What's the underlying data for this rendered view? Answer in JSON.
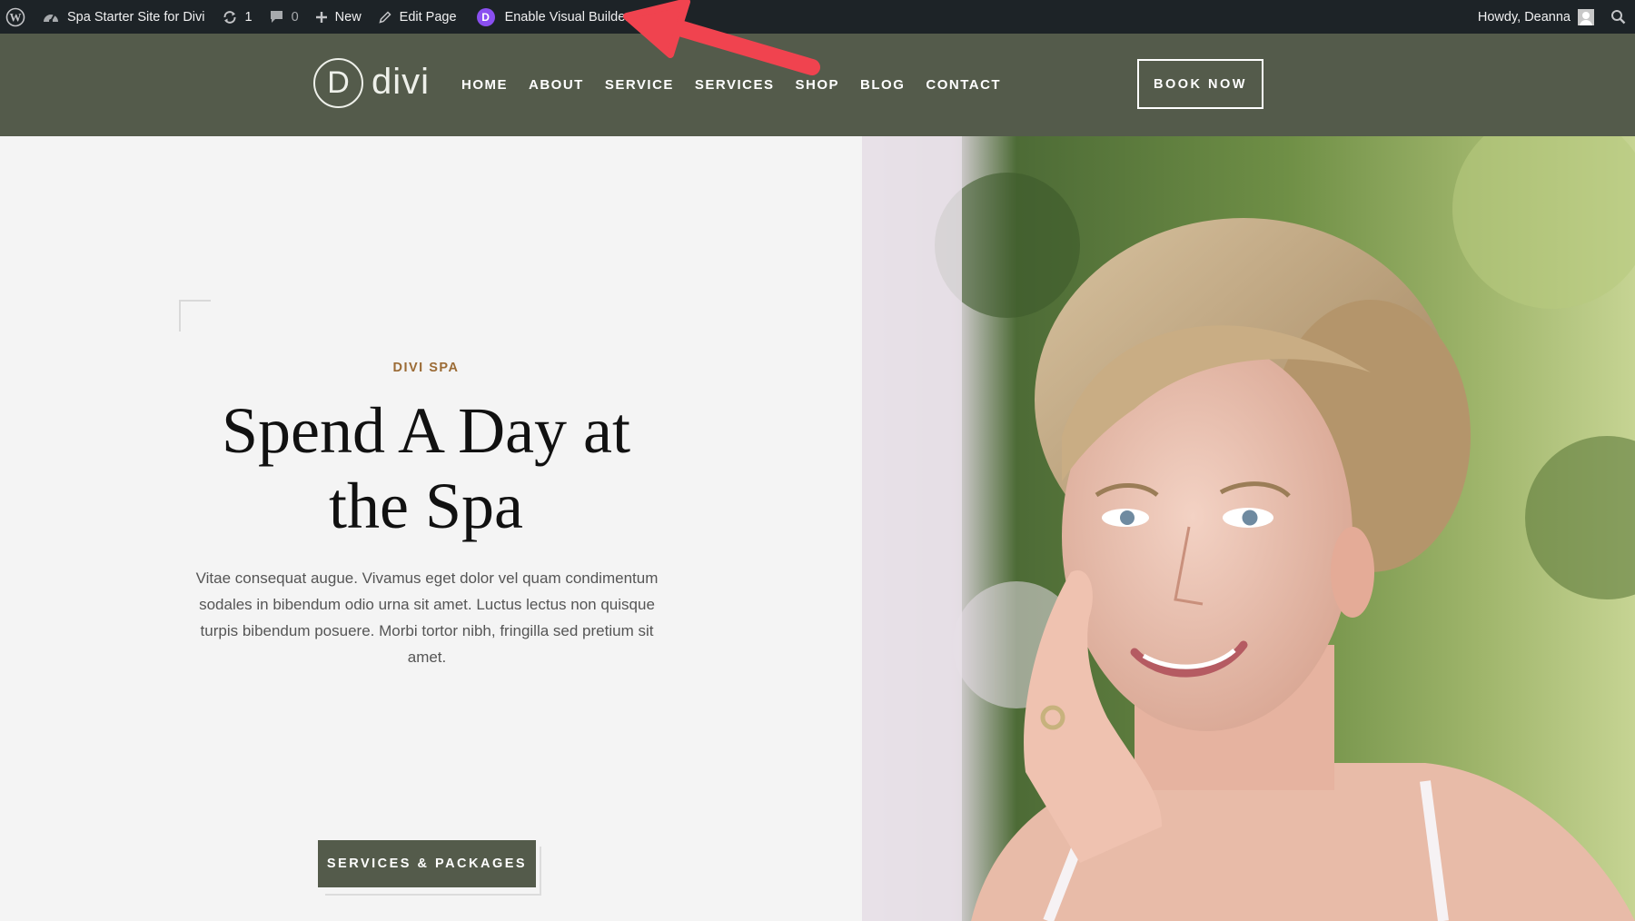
{
  "admin_bar": {
    "site_name": "Spa Starter Site for Divi",
    "updates_count": "1",
    "comments_count": "0",
    "new_label": "New",
    "edit_page_label": "Edit Page",
    "divi_badge": "D",
    "visual_builder_label": "Enable Visual Builder",
    "greeting": "Howdy, Deanna"
  },
  "header": {
    "logo_mark": "D",
    "logo_text": "divi",
    "nav": [
      "HOME",
      "ABOUT",
      "SERVICE",
      "SERVICES",
      "SHOP",
      "BLOG",
      "CONTACT"
    ],
    "book_now_label": "BOOK NOW"
  },
  "hero": {
    "eyebrow": "DIVI SPA",
    "headline_line1": "Spend A Day at",
    "headline_line2": "the Spa",
    "body": "Vitae consequat augue. Vivamus eget dolor vel quam condimentum sodales in bibendum odio urna sit amet. Luctus lectus non quisque turpis bibendum posuere. Morbi tortor nibh, fringilla sed pretium sit amet.",
    "cta_label": "SERVICES & PACKAGES"
  },
  "colors": {
    "admin_bar_bg": "#1d2327",
    "header_bg": "#545b4b",
    "eyebrow": "#9b6b35",
    "cta_bg": "#545b4b",
    "annotation_arrow": "#f0434f",
    "divi_purple": "#8a4ff0"
  },
  "icons": [
    "wordpress-icon",
    "site-dashboard-icon",
    "updates-icon",
    "comments-icon",
    "plus-icon",
    "pencil-icon",
    "divi-icon",
    "avatar",
    "search-icon",
    "red-arrow-annotation"
  ]
}
